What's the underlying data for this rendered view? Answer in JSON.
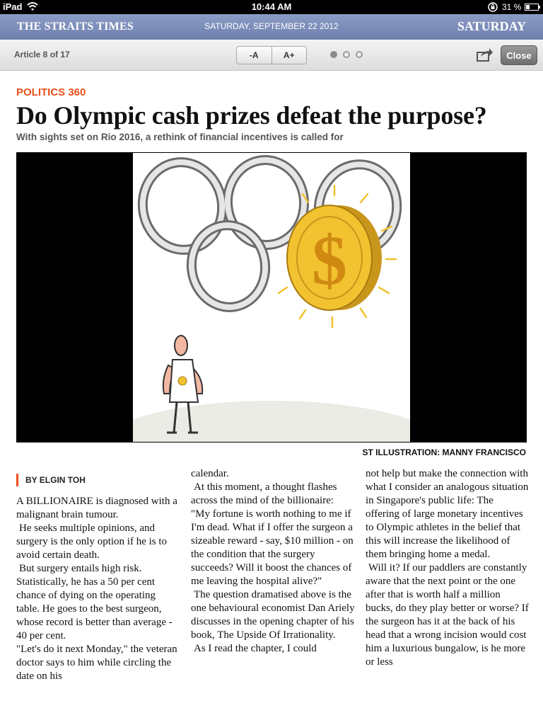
{
  "status_bar": {
    "device": "iPad",
    "time": "10:44 AM",
    "battery": "31 %"
  },
  "masthead": {
    "brand": "THE STRAITS TIMES",
    "date": "SATURDAY, SEPTEMBER 22 2012",
    "day": "SATURDAY"
  },
  "toolbar": {
    "article_count": "Article 8 of 17",
    "font_smaller": "-A",
    "font_larger": "A+",
    "close": "Close"
  },
  "article": {
    "kicker": "POLITICS 360",
    "headline": "Do Olympic cash prizes defeat the purpose?",
    "subhead": "With sights set on Rio 2016, a rethink of financial incentives is called for",
    "image_credit": "ST ILLUSTRATION: MANNY FRANCISCO",
    "byline": "BY ELGIN TOH",
    "col1": [
      "A BILLIONAIRE is diagnosed with a malignant brain tumour.",
      "He seeks multiple opinions, and surgery is the only option if he is to avoid certain death.",
      "But surgery entails high risk. Statistically, he has a 50 per cent chance of dying on the operating table. He goes to the best surgeon, whose record is better than average - 40 per cent.",
      "\"Let's do it next Monday,\" the veteran doctor says to him while circling the date on his"
    ],
    "col2": [
      "calendar.",
      "At this moment, a thought flashes across the mind of the billionaire: \"My fortune is worth nothing to me if I'm dead. What if I offer the surgeon a sizeable reward - say, $10 million - on the condition that the surgery succeeds? Will it boost the chances of me leaving the hospital alive?\"",
      "The question dramatised above is the one behavioural economist Dan Ariely discusses in the opening chapter of his book, The Upside Of Irrationality.",
      "As I read the chapter, I could"
    ],
    "col3": [
      "not help but make the connection with what I consider an analogous situation in Singapore's public life: The offering of large monetary incentives to Olympic athletes in the belief that this will increase the likelihood of them bringing home a medal.",
      "Will it? If our paddlers are constantly aware that the next point or the one after that is worth half a million bucks, do they play better or worse? If the surgeon has it at the back of his head that a wrong incision would cost him a luxurious bungalow, is he more or less"
    ]
  },
  "pagination": {
    "current": 1,
    "total": 3
  },
  "colors": {
    "accent": "#e8501c",
    "masthead": "#7d8dba",
    "coin": "#f2c230"
  },
  "icons": [
    "wifi-icon",
    "lock-rotation-icon",
    "battery-icon",
    "share-icon",
    "dollar-coin"
  ]
}
